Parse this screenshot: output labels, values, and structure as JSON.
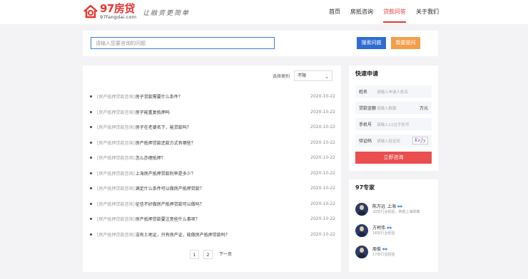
{
  "header": {
    "logo_cn": "97房贷",
    "logo_en": "97fangdai.com",
    "slogan": "让融资更简单",
    "nav": [
      {
        "label": "首页"
      },
      {
        "label": "房抵咨询"
      },
      {
        "label": "贷款问答"
      },
      {
        "label": "关于我们"
      }
    ],
    "active_nav": "贷款问答"
  },
  "search": {
    "placeholder": "请输入您要咨询的问题",
    "search_label": "搜索问题",
    "ask_label": "我要提问"
  },
  "filter": {
    "label": "选择类别",
    "value": "不限"
  },
  "questions": [
    {
      "category": "[房产抵押贷款咨询]",
      "title": "房子贷款需要什么条件？",
      "date": "2020-10-22"
    },
    {
      "category": "[房产抵押贷款咨询]",
      "title": "房子能重复抵押吗",
      "date": "2020-10-22"
    },
    {
      "category": "[房产抵押贷款咨询]",
      "title": "房子在老婆名下，能贷款吗？",
      "date": "2020-10-22"
    },
    {
      "category": "[房产抵押贷款咨询]",
      "title": "房产抵押贷款还款方式有哪些？",
      "date": "2020-10-22"
    },
    {
      "category": "[房产抵押贷款咨询]",
      "title": "怎么办理抵押？",
      "date": "2020-10-22"
    },
    {
      "category": "[房产抵押贷款咨询]",
      "title": "上海房产抵押贷款利率是多少？",
      "date": "2020-10-22"
    },
    {
      "category": "[房产抵押贷款咨询]",
      "title": "满足什么条件可以做房产抵押贷款？",
      "date": "2020-10-22"
    },
    {
      "category": "[房产抵押贷款咨询]",
      "title": "征信不好做房产抵押贷款可以做吗？",
      "date": "2020-10-22"
    },
    {
      "category": "[房产抵押贷款咨询]",
      "title": "房产抵押贷款要注意些什么事项？",
      "date": "2020-10-22"
    },
    {
      "category": "[房产抵押贷款咨询]",
      "title": "没有土地证，只有房产证，能做房产抵押贷款吗？",
      "date": "2020-10-22"
    }
  ],
  "pager": {
    "p1": "1",
    "p2": "2",
    "next": "下一页"
  },
  "apply": {
    "title": "快速申请",
    "name_label": "姓名",
    "name_placeholder": "请输入申请人姓名",
    "amount_label": "贷款金额",
    "amount_placeholder": "请输入数额",
    "amount_unit": "万元",
    "phone_label": "手机号",
    "phone_placeholder": "请输入11位手机号",
    "code_label": "验证码",
    "code_placeholder": "请输入验证码",
    "captcha_text": "KeJy",
    "submit": "立即咨询"
  },
  "experts": {
    "title": "97专家",
    "list": [
      {
        "name": "陈万远",
        "city": "上海",
        "desc": "20年行业经验，熟悉上海政策"
      },
      {
        "name": "方柯伟",
        "city": "",
        "desc": "16年行业经验"
      },
      {
        "name": "周俊",
        "city": "",
        "desc": "17年行业经验"
      }
    ]
  }
}
